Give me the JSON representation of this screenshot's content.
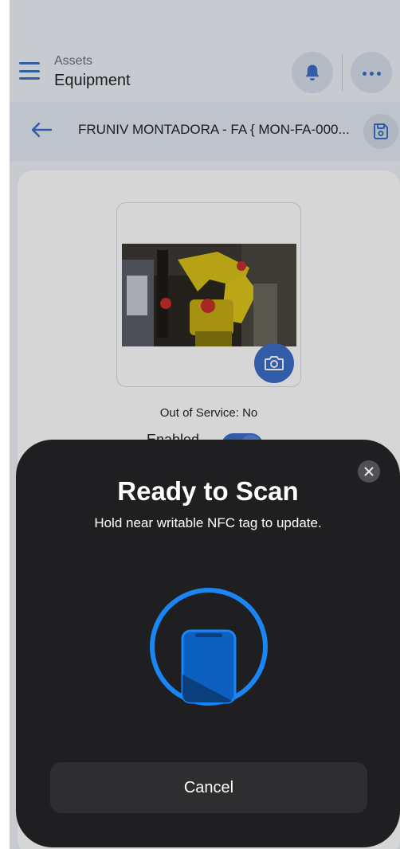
{
  "colors": {
    "accent": "#3d6ec9",
    "nfc_ring": "#1a86f5",
    "sheet_background": "#1f1f21",
    "page_background": "#eef1f6"
  },
  "header": {
    "menu_icon": "hamburger-menu-icon",
    "subtitle": "Assets",
    "title": "Equipment",
    "notification_icon": "bell-icon",
    "more_icon": "ellipsis-icon"
  },
  "record_bar": {
    "back_icon": "arrow-left-icon",
    "title": "FRUNIV MONTADORA - FA { MON-FA-000...",
    "save_icon": "save-icon"
  },
  "equipment": {
    "photo_icon": "camera-icon",
    "out_of_service": "Out of Service: No",
    "enabled_label": "Enabled",
    "enabled": true
  },
  "nfc_sheet": {
    "title": "Ready to Scan",
    "message": "Hold near writable NFC tag to update.",
    "close_icon": "close-icon",
    "illustration": "phone-nfc-icon",
    "cancel_label": "Cancel"
  }
}
